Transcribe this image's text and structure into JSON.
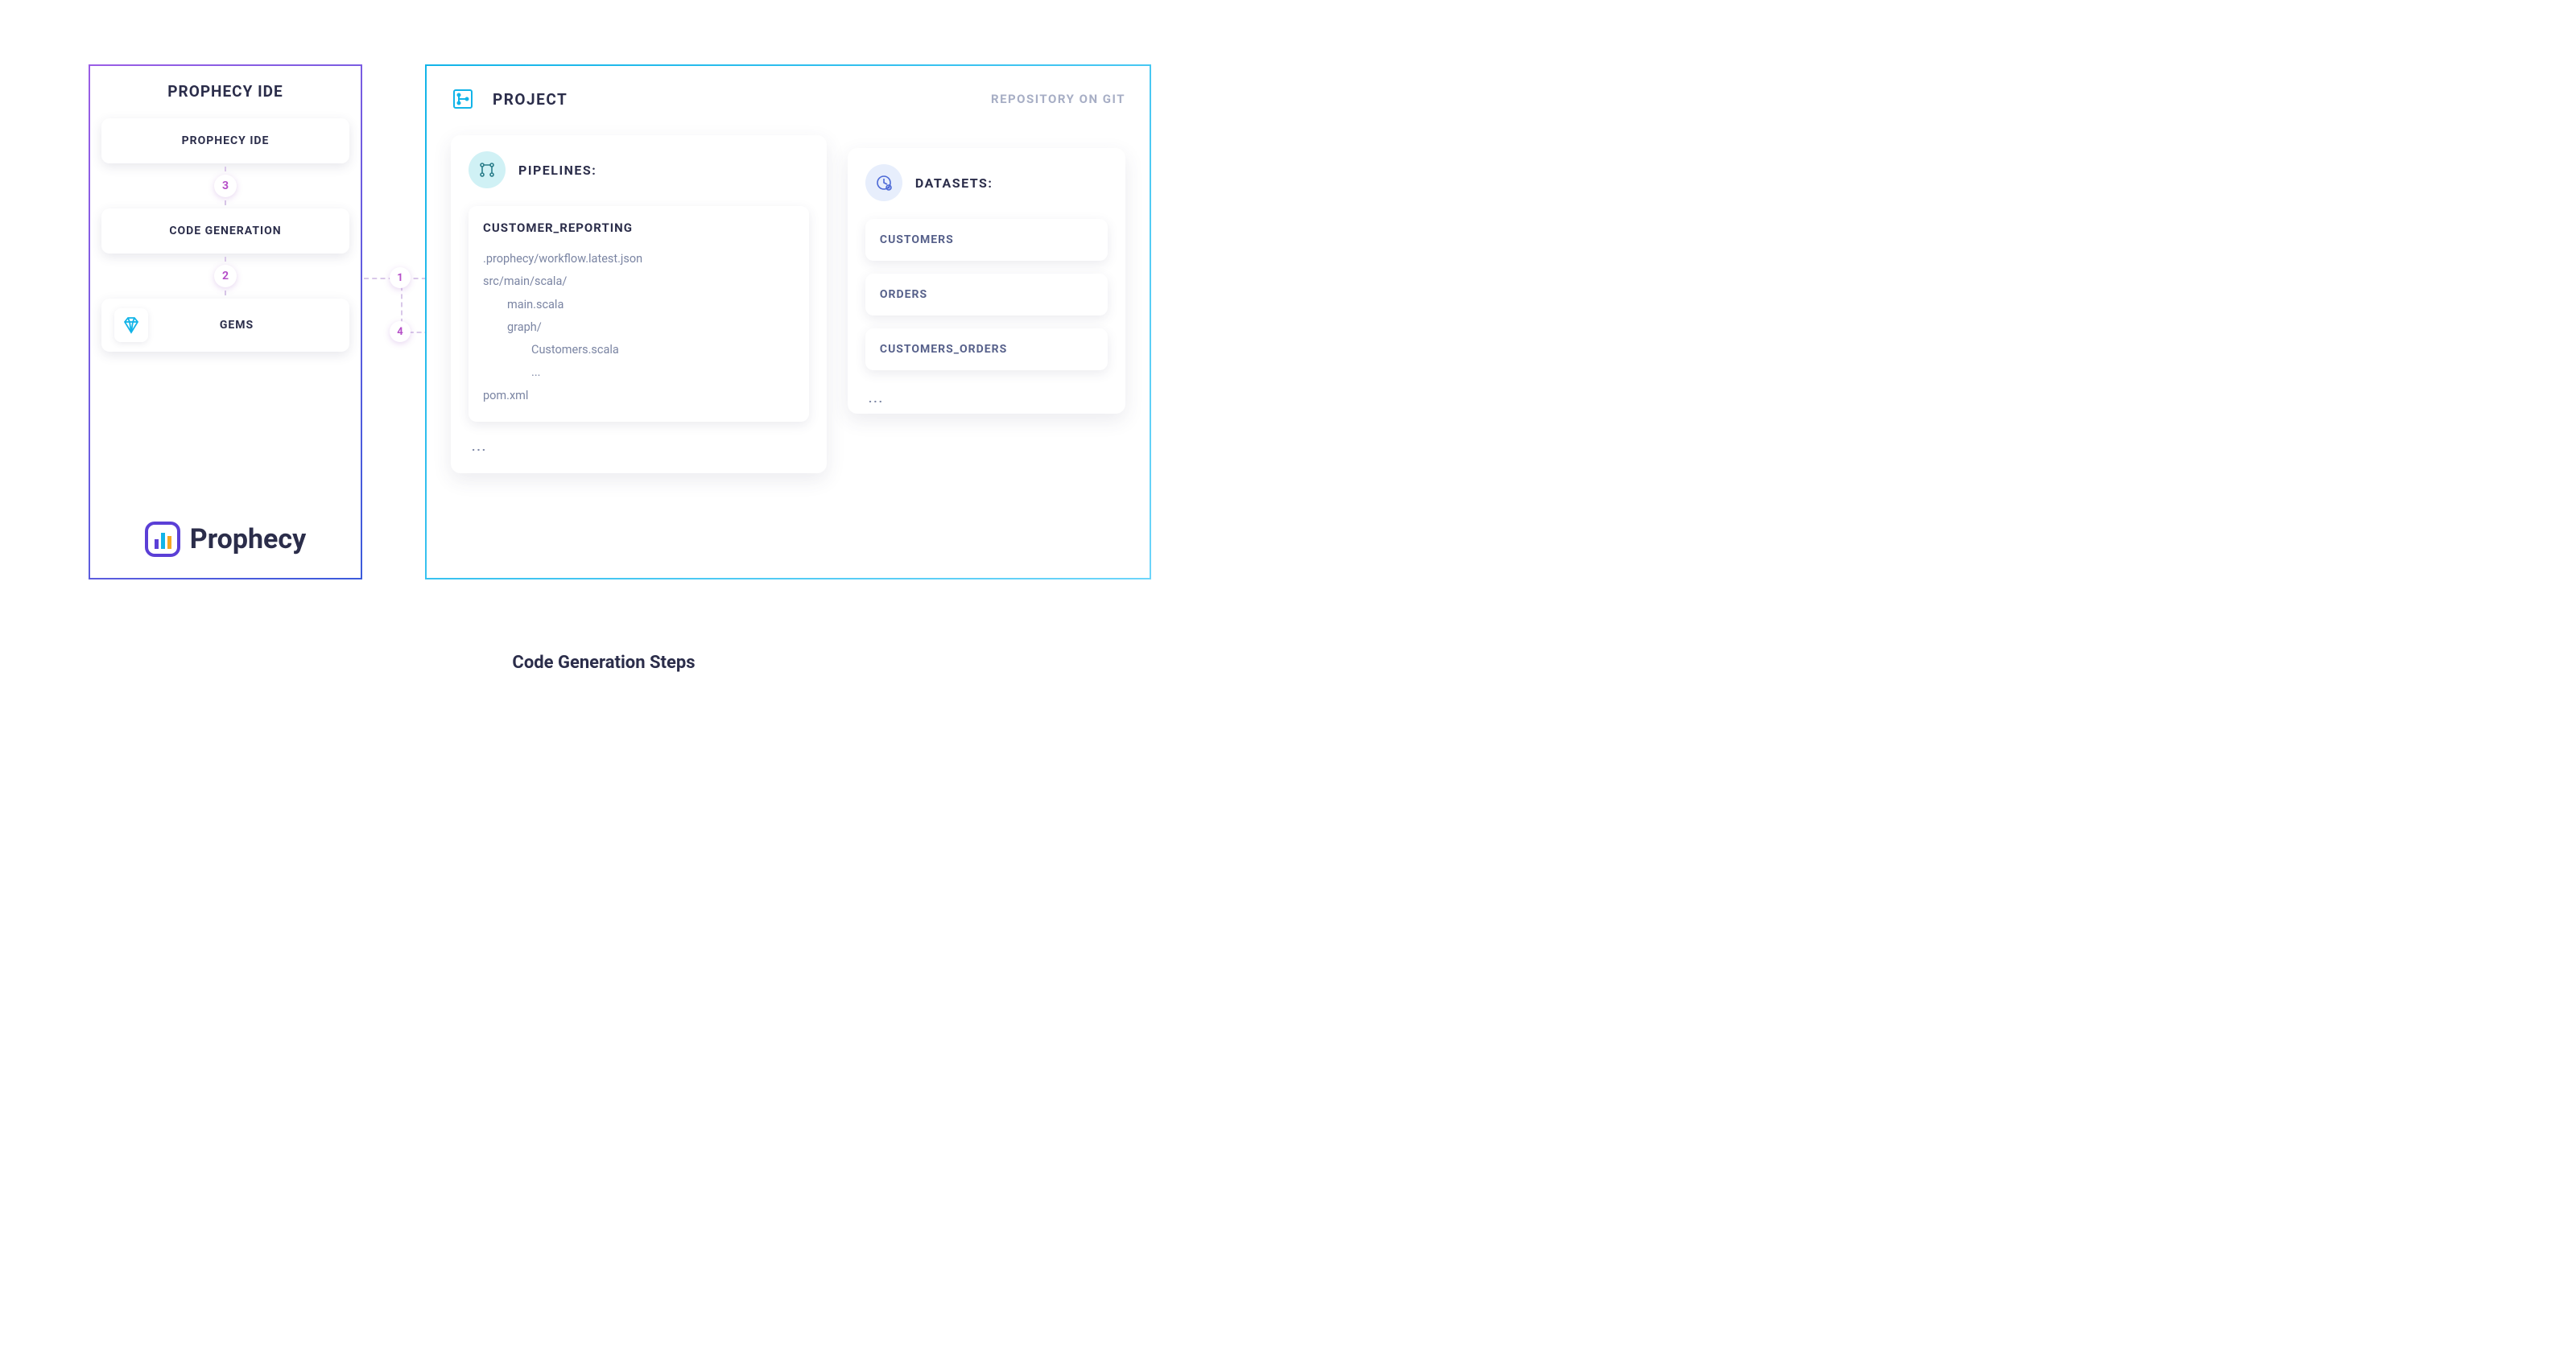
{
  "ide": {
    "panel_title": "PROPHECY IDE",
    "cards": {
      "ide": "PROPHECY IDE",
      "codegen": "CODE GENERATION",
      "gems": "GEMS"
    },
    "badges": {
      "top": "3",
      "bottom": "2"
    },
    "logo_text": "Prophecy"
  },
  "project": {
    "title": "PROJECT",
    "repo_label": "REPOSITORY ON GIT",
    "pipelines": {
      "title": "PIPELINES:",
      "item_title": "CUSTOMER_REPORTING",
      "tree": {
        "l0a": ".prophecy/workflow.latest.json",
        "l0b": "src/main/scala/",
        "l1a": "main.scala",
        "l1b": "graph/",
        "l2a": "Customers.scala",
        "l2b": "...",
        "l0c": "pom.xml"
      },
      "more": "..."
    },
    "datasets": {
      "title": "DATASETS:",
      "items": [
        "CUSTOMERS",
        "ORDERS",
        "CUSTOMERS_ORDERS"
      ],
      "more": "..."
    }
  },
  "connectors": {
    "c1": "1",
    "c4": "4"
  },
  "caption": "Code Generation Steps"
}
